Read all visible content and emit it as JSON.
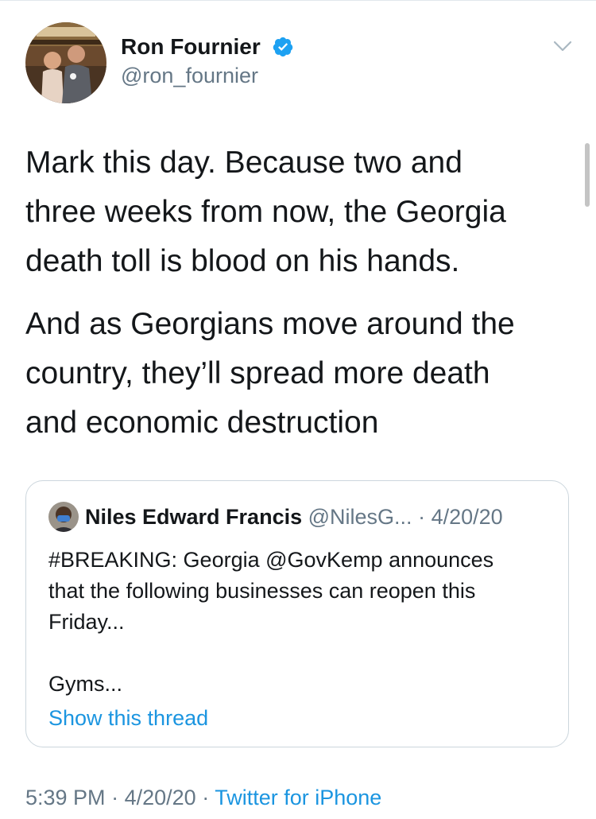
{
  "tweet": {
    "author": {
      "name": "Ron Fournier",
      "handle": "@ron_fournier",
      "verified": true,
      "avatar": "profile-photo"
    },
    "paragraphs": [
      [
        "Mark this day. Because two and",
        "three weeks from now, the Georgia",
        "death toll is blood on his hands."
      ],
      [
        "And as Georgians move around the",
        "country, they’ll spread more death",
        "and economic destruction"
      ]
    ],
    "quoted": {
      "name": "Niles Edward Francis",
      "handle": "@NilesG...",
      "separator": "·",
      "date": "4/20/20",
      "lines": [
        "#BREAKING: Georgia @GovKemp announces",
        "that the following businesses can reopen this",
        "Friday...",
        "Gyms..."
      ],
      "show_thread": "Show this thread"
    },
    "meta": {
      "time": "5:39 PM",
      "separator": "·",
      "date": "4/20/20",
      "source": "Twitter for iPhone"
    }
  },
  "icons": {
    "verified": "verified-badge-icon",
    "more": "chevron-down-icon"
  },
  "colors": {
    "link": "#1b95e0",
    "secondary_text": "#657786",
    "primary_text": "#14171a",
    "border": "#ccd6dd"
  }
}
